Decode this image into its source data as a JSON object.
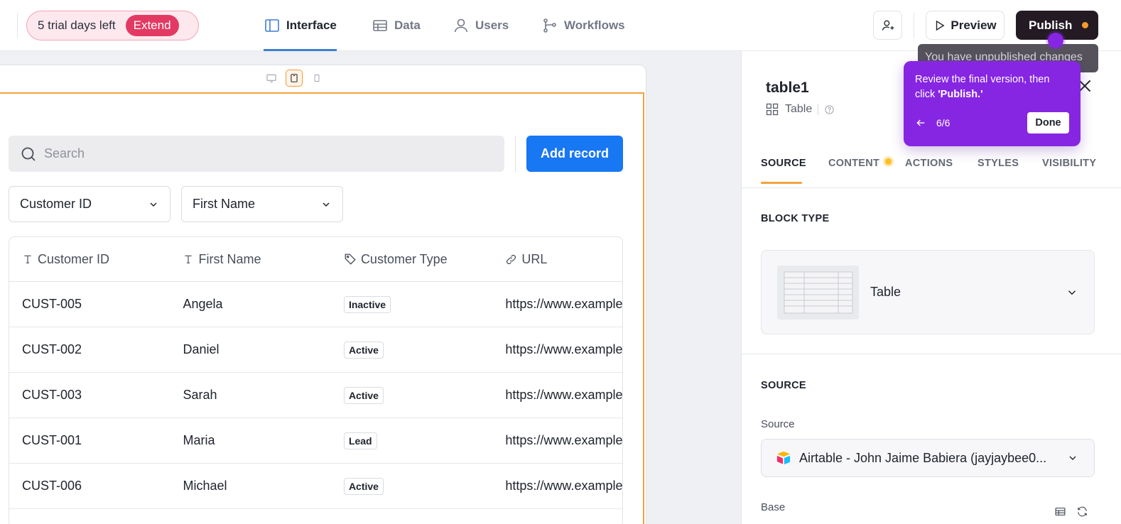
{
  "topbar": {
    "trial_text": "5 trial days left",
    "extend_label": "Extend",
    "tabs": [
      {
        "label": "Interface",
        "icon": "layout-sidebar-icon"
      },
      {
        "label": "Data",
        "icon": "table-icon"
      },
      {
        "label": "Users",
        "icon": "user-icon"
      },
      {
        "label": "Workflows",
        "icon": "workflow-icon"
      }
    ],
    "preview_label": "Preview",
    "publish_label": "Publish"
  },
  "canvas": {
    "search_placeholder": "Search",
    "add_record_label": "Add record",
    "filters": [
      "Customer ID",
      "First Name"
    ],
    "table": {
      "columns": [
        "Customer ID",
        "First Name",
        "Customer Type",
        "URL"
      ],
      "rows": [
        {
          "id": "CUST-005",
          "name": "Angela",
          "type": "Inactive",
          "url": "https://www.example.com"
        },
        {
          "id": "CUST-002",
          "name": "Daniel",
          "type": "Active",
          "url": "https://www.example.com"
        },
        {
          "id": "CUST-003",
          "name": "Sarah",
          "type": "Active",
          "url": "https://www.example.com"
        },
        {
          "id": "CUST-001",
          "name": "Maria",
          "type": "Lead",
          "url": "https://www.example.com"
        },
        {
          "id": "CUST-006",
          "name": "Michael",
          "type": "Active",
          "url": "https://www.example.com"
        }
      ]
    }
  },
  "panel": {
    "title": "table1",
    "subtitle": "Table",
    "tabs": [
      "SOURCE",
      "CONTENT",
      "ACTIONS",
      "STYLES",
      "VISIBILITY"
    ],
    "block_type_heading": "BLOCK TYPE",
    "block_type_value": "Table",
    "source_heading": "SOURCE",
    "source_label": "Source",
    "source_value": "Airtable - John Jaime Babiera (jayjaybee0...",
    "base_label": "Base"
  },
  "tooltips": {
    "unpublished": "You have unpublished changes",
    "tour_text_plain": "Review the final version, then click ",
    "tour_text_bold": "'Publish.'",
    "tour_step": "6/6",
    "tour_done": "Done"
  },
  "colors": {
    "accent_blue": "#1877f2",
    "publish_bg": "#231a24",
    "tour_purple": "#8626e3",
    "selection_orange": "#f4a33d",
    "extend_red": "#e23a62"
  }
}
